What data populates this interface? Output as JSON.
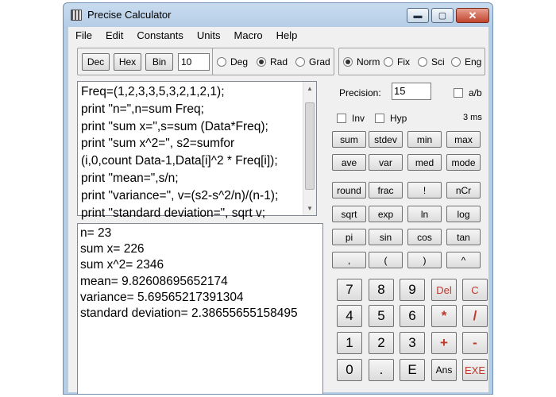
{
  "window": {
    "title": "Precise Calculator",
    "icon": "calculator-app-icon"
  },
  "title_buttons": {
    "minimize": "▬",
    "maximize": "▢",
    "close": "✕"
  },
  "menu": [
    "File",
    "Edit",
    "Constants",
    "Units",
    "Macro",
    "Help"
  ],
  "base": {
    "buttons": [
      "Dec",
      "Hex",
      "Bin"
    ],
    "digits_value": "10"
  },
  "angle": {
    "options": [
      "Deg",
      "Rad",
      "Grad"
    ],
    "selected": "Rad"
  },
  "format": {
    "options": [
      "Norm",
      "Fix",
      "Sci",
      "Eng"
    ],
    "selected": "Norm"
  },
  "precision": {
    "label": "Precision:",
    "value": "15",
    "ab_label": "a/b"
  },
  "flags": {
    "inv": "Inv",
    "hyp": "Hyp",
    "timing": "3 ms"
  },
  "program_lines": [
    "Freq=(1,2,3,3,5,3,2,1,2,1);",
    "print \"n=\",n=sum Freq;",
    "print \"sum x=\",s=sum (Data*Freq);",
    "print \"sum x^2=\", s2=sumfor",
    "(i,0,count Data-1,Data[i]^2 * Freq[i]);",
    "print \"mean=\",s/n;",
    "print \"variance=\", v=(s2-s^2/n)/(n-1);",
    "print \"standard deviation=\", sqrt v;"
  ],
  "output_lines": [
    "n= 23",
    "sum x= 226",
    "sum x^2= 2346",
    "mean= 9.82608695652174",
    "variance= 5.69565217391304",
    "standard deviation= 2.38655655158495"
  ],
  "function_buttons": [
    [
      "sum",
      "stdev",
      "min",
      "max"
    ],
    [
      "ave",
      "var",
      "med",
      "mode"
    ],
    [
      "round",
      "frac",
      "!",
      "nCr"
    ],
    [
      "sqrt",
      "exp",
      "ln",
      "log"
    ],
    [
      "pi",
      "sin",
      "cos",
      "tan"
    ],
    [
      ",",
      "(",
      ")",
      "^"
    ]
  ],
  "numpad": [
    [
      "7",
      "8",
      "9",
      "Del",
      "C"
    ],
    [
      "4",
      "5",
      "6",
      "*",
      "/"
    ],
    [
      "1",
      "2",
      "3",
      "+",
      "-"
    ],
    [
      "0",
      ".",
      "E",
      "Ans",
      "EXE"
    ]
  ]
}
